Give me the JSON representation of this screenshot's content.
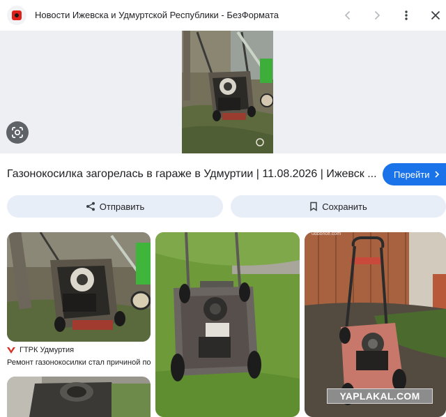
{
  "header": {
    "site_title": "Новости Ижевска и Удмуртской Республики - БезФормата",
    "icons": [
      "back-icon",
      "forward-icon",
      "more-vert-icon",
      "close-icon"
    ]
  },
  "hero": {
    "lens_icon": "google-lens-icon"
  },
  "result": {
    "headline": "Газонокосилка загорелась в гараже в Удмуртии | 11.08.2026 | Ижевск ...",
    "go_label": "Перейти",
    "share_label": "Отправить",
    "save_label": "Сохранить"
  },
  "related": [
    {
      "source": "ГТРК Удмуртия",
      "snippet": "Ремонт газонокосилки стал причиной пожара в ..."
    }
  ],
  "overlays": {
    "watermark": "YAPLAKAL.COM",
    "photo_credit": "udbonce.com"
  },
  "colors": {
    "accent": "#1a73e8",
    "chip_bg": "#e8eef7",
    "favicon": "#e0201b"
  }
}
